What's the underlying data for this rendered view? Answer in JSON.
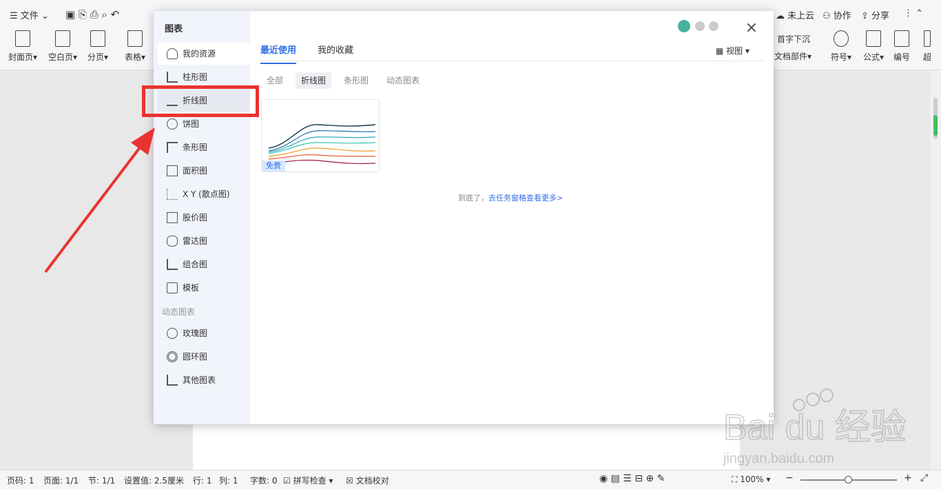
{
  "toolbar": {
    "file": "文件",
    "cloud": "未上云",
    "collab": "协作",
    "share": "分享"
  },
  "ribbon": {
    "items": [
      "封面页",
      "空白页",
      "分页",
      "表格"
    ],
    "right_items": [
      "首字下沉",
      "文档部件",
      "符号",
      "公式",
      "编号",
      "超"
    ]
  },
  "dialog": {
    "title": "图表",
    "close_label": "×",
    "view_label": "视图",
    "nav": [
      {
        "label": "我的资源"
      },
      {
        "label": "柱形图"
      },
      {
        "label": "折线图"
      },
      {
        "label": "饼图"
      },
      {
        "label": "条形图"
      },
      {
        "label": "面积图"
      },
      {
        "label": "X Y (散点图)"
      },
      {
        "label": "股价图"
      },
      {
        "label": "雷达图"
      },
      {
        "label": "组合图"
      },
      {
        "label": "模板"
      }
    ],
    "dynamic_header": "动态图表",
    "dynamic_nav": [
      {
        "label": "玫瑰图"
      },
      {
        "label": "圆环图"
      },
      {
        "label": "其他图表"
      }
    ],
    "tabs": [
      {
        "label": "最近使用"
      },
      {
        "label": "我的收藏"
      }
    ],
    "filters": [
      {
        "label": "全部"
      },
      {
        "label": "折线图"
      },
      {
        "label": "条形图"
      },
      {
        "label": "动态图表"
      }
    ],
    "card": {
      "badge": "免费"
    },
    "end_text": "到底了，",
    "end_link": "去任务窗格查看更多>"
  },
  "statusbar": {
    "page_no": "页码: 1",
    "pages": "页面: 1/1",
    "section": "节: 1/1",
    "setting": "设置值: 2.5厘米",
    "row": "行: 1",
    "col": "列: 1",
    "words": "字数: 0",
    "spell": "拼写检查",
    "proof": "文档校对",
    "zoom": "100%"
  },
  "colors": {
    "accent": "#2f6fe3",
    "highlight": "#ea3330"
  }
}
